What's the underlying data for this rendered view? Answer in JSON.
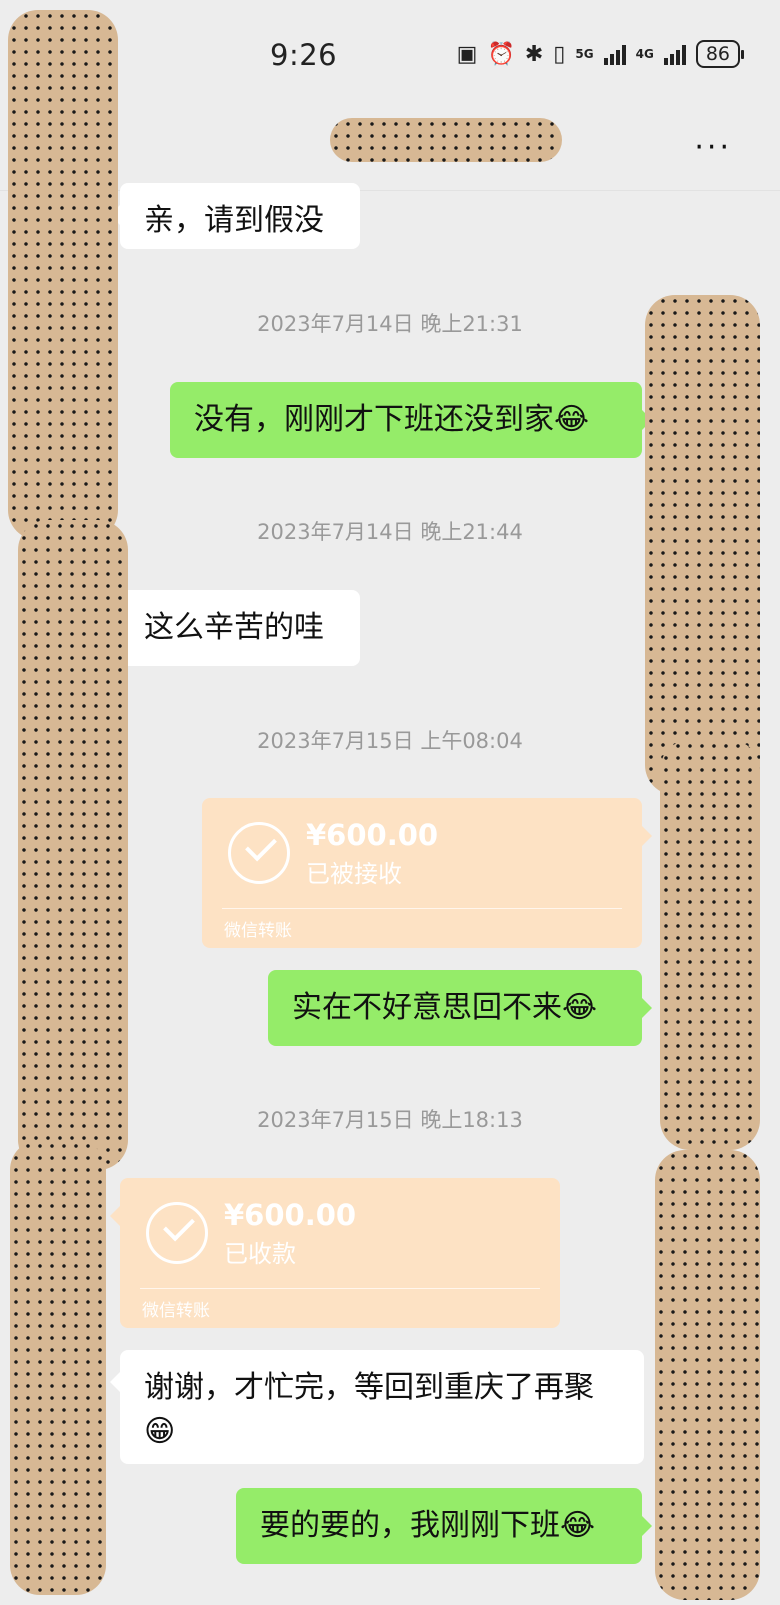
{
  "status_bar": {
    "time": "9:26",
    "network_5g": "5G",
    "network_4g": "4G",
    "battery": "86"
  },
  "nav": {
    "more_label": "···"
  },
  "messages": [
    {
      "side": "left",
      "text": "亲，请到假没"
    },
    {
      "timestamp": "2023年7月14日 晚上21:31"
    },
    {
      "side": "right",
      "text": "没有，刚刚才下班还没到家",
      "emoji": "😂"
    },
    {
      "timestamp": "2023年7月14日 晚上21:44"
    },
    {
      "side": "left",
      "text": "这么辛苦的哇"
    },
    {
      "timestamp": "2023年7月15日 上午08:04"
    },
    {
      "side": "right",
      "transfer": {
        "amount": "¥600.00",
        "status": "已被接收",
        "label": "微信转账"
      }
    },
    {
      "side": "right",
      "text": "实在不好意思回不来",
      "emoji": "😂"
    },
    {
      "timestamp": "2023年7月15日 晚上18:13"
    },
    {
      "side": "left",
      "transfer": {
        "amount": "¥600.00",
        "status": "已收款",
        "label": "微信转账"
      }
    },
    {
      "side": "left",
      "text": "谢谢，才忙完，等回到重庆了再聚",
      "emoji": "😁"
    },
    {
      "side": "right",
      "text": "要的要的，我刚刚下班",
      "emoji": "😂"
    }
  ],
  "colors": {
    "background": "#ededed",
    "outgoing_bubble": "#95ec69",
    "incoming_bubble": "#ffffff",
    "transfer_card": "#fde2c4"
  }
}
